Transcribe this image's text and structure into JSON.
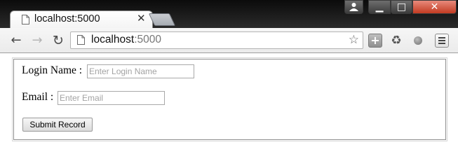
{
  "browser": {
    "tab": {
      "title": "localhost:5000",
      "close_glyph": "✕"
    },
    "address": {
      "host": "localhost",
      "port": ":5000"
    },
    "icons": {
      "tab_page": "page-icon",
      "back": "arrow-left-icon",
      "forward": "arrow-right-icon",
      "reload": "reload-icon",
      "bookmark": "star-icon",
      "extension": "plus-extension-icon",
      "recycle": "recycle-icon",
      "status_dot": "circle-icon",
      "menu": "hamburger-menu-icon"
    },
    "window_buttons": {
      "minimize": "▁",
      "maximize": "□",
      "close": "✕"
    }
  },
  "form": {
    "login_label": "Login Name :",
    "login_placeholder": "Enter Login Name",
    "login_value": "",
    "email_label": "Email :",
    "email_placeholder": "Enter Email",
    "email_value": "",
    "submit_label": "Submit Record"
  },
  "colors": {
    "close_button": "#c33b22",
    "chrome_dark": "#1e1e1e"
  }
}
